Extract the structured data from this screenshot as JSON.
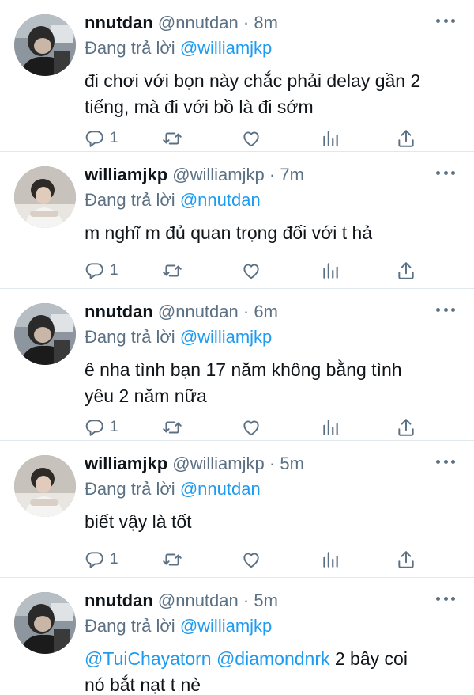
{
  "reply_prefix": "Đang trả lời",
  "tweets": [
    {
      "name": "nnutdan",
      "handle": "@nnutdan",
      "dot": "·",
      "time": "8m",
      "reply_to": "@williamjkp",
      "text_lines": [
        "đi chơi với bọn này chắc phải delay gần 2",
        "tiếng, mà đi với bồ là đi sớm"
      ],
      "reply_count": "1"
    },
    {
      "name": "williamjkp",
      "handle": "@williamjkp",
      "dot": "·",
      "time": "7m",
      "reply_to": "@nnutdan",
      "text_lines": [
        "m nghĩ m đủ quan trọng đối với t hả"
      ],
      "reply_count": "1"
    },
    {
      "name": "nnutdan",
      "handle": "@nnutdan",
      "dot": "·",
      "time": "6m",
      "reply_to": "@williamjkp",
      "text_lines": [
        "ê nha tình bạn 17 năm không bằng tình",
        "yêu 2 năm nữa"
      ],
      "reply_count": "1"
    },
    {
      "name": "williamjkp",
      "handle": "@williamjkp",
      "dot": "·",
      "time": "5m",
      "reply_to": "@nnutdan",
      "text_lines": [
        "biết vậy là tốt"
      ],
      "reply_count": "1"
    },
    {
      "name": "nnutdan",
      "handle": "@nnutdan",
      "dot": "·",
      "time": "5m",
      "reply_to": "@williamjkp",
      "mention_1": "@TuiChayatorn",
      "mention_2": "@diamondnrk",
      "text_after_mentions": "2 bây coi",
      "text_line_2": "nó bắt nạt t nè"
    }
  ],
  "icons": {
    "reply": "reply-icon",
    "retweet": "retweet-icon",
    "like": "heart-icon",
    "stats": "stats-icon",
    "share": "share-icon",
    "more": "more-icon"
  },
  "colors": {
    "mention": "#1d9bf0",
    "secondary_text": "#5b7083",
    "primary_text": "#0f1419",
    "divider": "#e1e8ed"
  }
}
